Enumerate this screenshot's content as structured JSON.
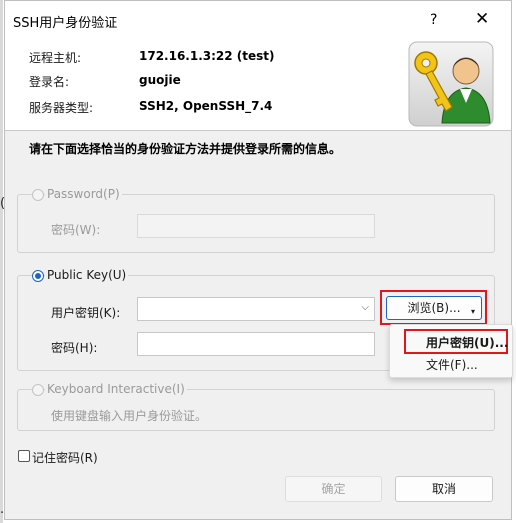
{
  "window": {
    "title": "SSH用户身份验证",
    "help_glyph": "?",
    "close_glyph": "✕"
  },
  "info": {
    "host_label": "远程主机:",
    "host_value": "172.16.1.3:22 (test)",
    "login_label": "登录名:",
    "login_value": "guojie",
    "server_label": "服务器类型:",
    "server_value": "SSH2, OpenSSH_7.4",
    "logo_icon": "key-user-icon"
  },
  "instruction": "请在下面选择恰当的身份验证方法并提供登录所需的信息。",
  "password_group": {
    "title": "Password(P)",
    "password_label": "密码(W):",
    "selected": false,
    "enabled": false
  },
  "publickey_group": {
    "title": "Public Key(U)",
    "selected": true,
    "user_key_label": "用户密钥(K):",
    "user_key_value": "",
    "passphrase_label": "密码(H):",
    "passphrase_value": "",
    "browse_label": "浏览(B)...",
    "browse_arrow": "▾"
  },
  "browse_menu": {
    "items": [
      "用户密钥(U)...",
      "文件(F)..."
    ]
  },
  "keyboard_group": {
    "title": "Keyboard Interactive(I)",
    "description": "使用键盘输入用户身份验证。",
    "selected": false
  },
  "remember": {
    "label": "记住密码(R)",
    "checked": false
  },
  "buttons": {
    "ok": "确定",
    "cancel": "取消"
  },
  "colors": {
    "highlight": "#e3161d",
    "accent": "#1d64c6"
  }
}
